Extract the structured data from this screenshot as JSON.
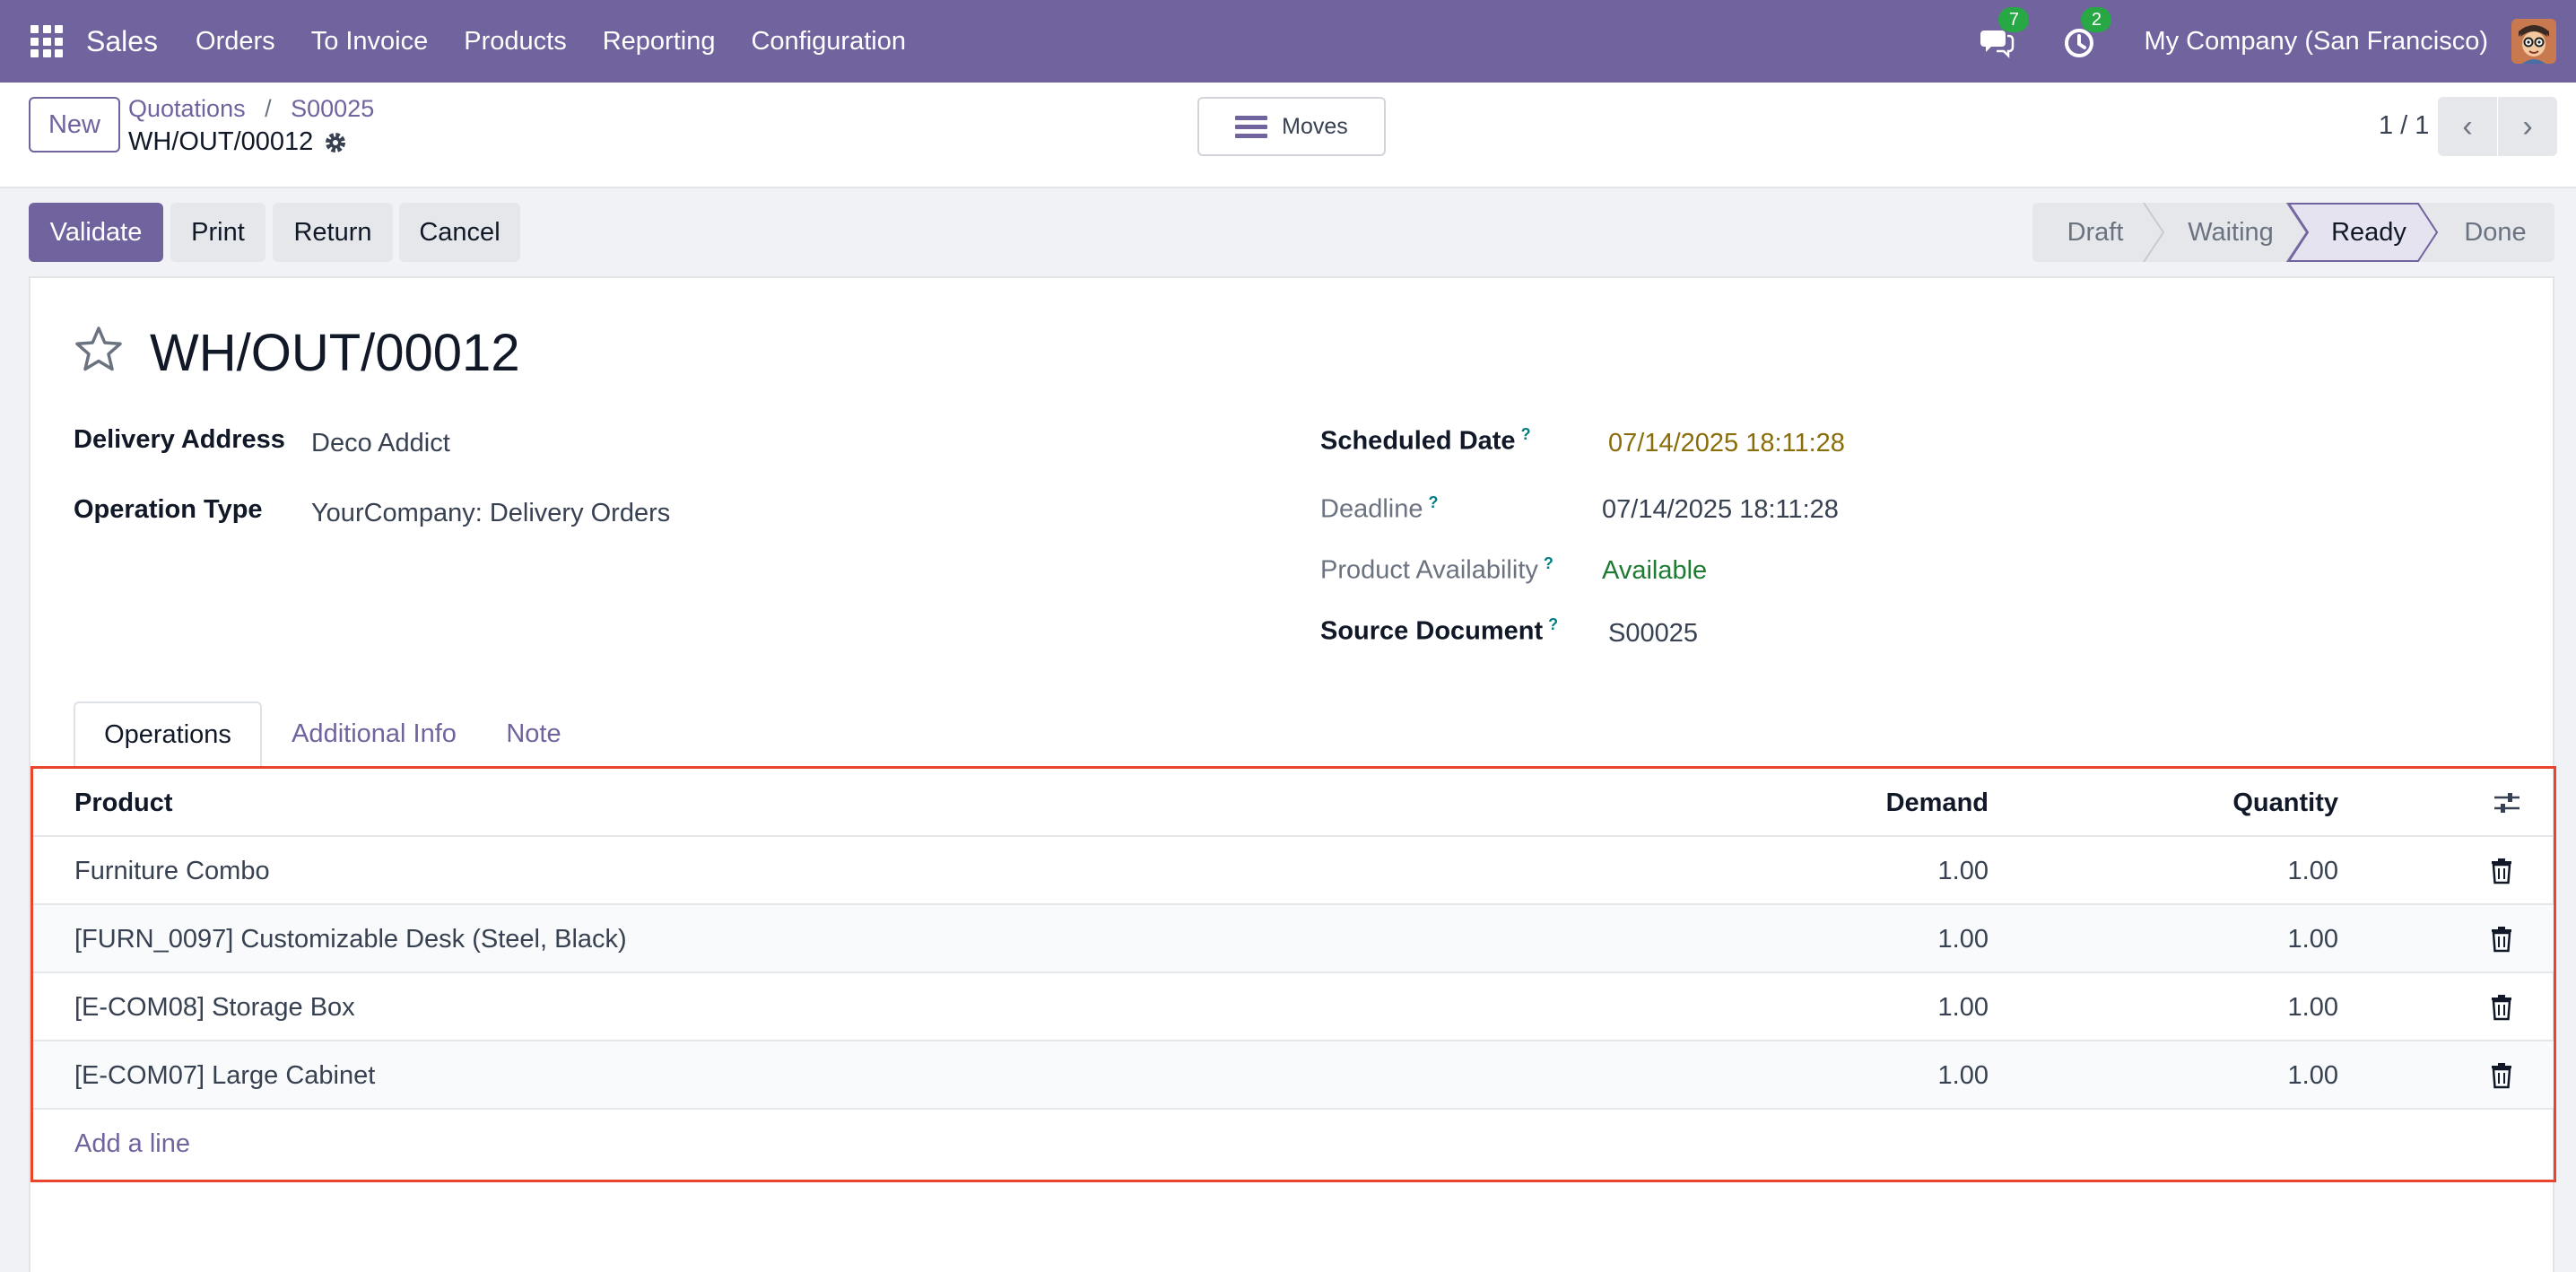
{
  "navbar": {
    "brand": "Sales",
    "menu": [
      "Orders",
      "To Invoice",
      "Products",
      "Reporting",
      "Configuration"
    ],
    "messages_count": "7",
    "activities_count": "2",
    "company": "My Company (San Francisco)"
  },
  "control": {
    "new_label": "New",
    "breadcrumb": [
      "Quotations",
      "S00025"
    ],
    "record_name": "WH/OUT/00012",
    "moves_label": "Moves",
    "pager": "1 / 1"
  },
  "actions": {
    "validate": "Validate",
    "print": "Print",
    "return": "Return",
    "cancel": "Cancel"
  },
  "stages": {
    "draft": "Draft",
    "waiting": "Waiting",
    "ready": "Ready",
    "done": "Done",
    "current": "Ready"
  },
  "form": {
    "title": "WH/OUT/00012",
    "delivery_address_label": "Delivery Address",
    "delivery_address": "Deco Addict",
    "operation_type_label": "Operation Type",
    "operation_type": "YourCompany: Delivery Orders",
    "scheduled_date_label": "Scheduled Date",
    "scheduled_date": "07/14/2025 18:11:28",
    "deadline_label": "Deadline",
    "deadline": "07/14/2025 18:11:28",
    "availability_label": "Product Availability",
    "availability": "Available",
    "source_doc_label": "Source Document",
    "source_doc": "S00025",
    "help_mark": "?"
  },
  "tabs": [
    "Operations",
    "Additional Info",
    "Note"
  ],
  "table": {
    "headers": {
      "product": "Product",
      "demand": "Demand",
      "quantity": "Quantity"
    },
    "rows": [
      {
        "product": "Furniture Combo",
        "demand": "1.00",
        "quantity": "1.00"
      },
      {
        "product": "[FURN_0097] Customizable Desk (Steel, Black)",
        "demand": "1.00",
        "quantity": "1.00"
      },
      {
        "product": "[E-COM08] Storage Box",
        "demand": "1.00",
        "quantity": "1.00"
      },
      {
        "product": "[E-COM07] Large Cabinet",
        "demand": "1.00",
        "quantity": "1.00"
      }
    ],
    "add_line": "Add a line"
  },
  "colors": {
    "brand": "#71639e",
    "highlight_border": "#e8452c",
    "available": "#1f7a34",
    "scheduled": "#8a6d0b"
  }
}
